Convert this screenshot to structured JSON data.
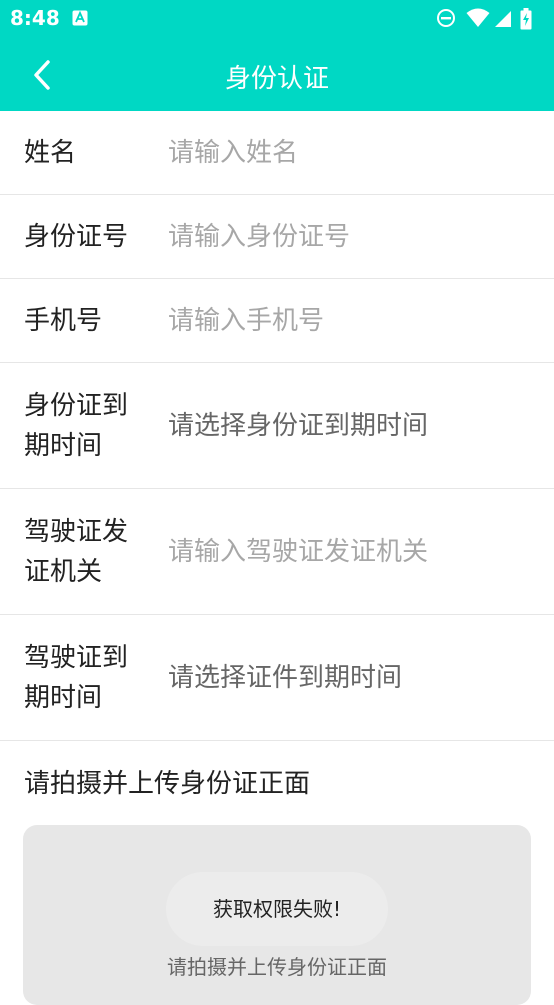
{
  "status_bar": {
    "time": "8:48",
    "icons": [
      "a-notification-icon",
      "do-not-disturb-icon",
      "wifi-icon",
      "cell-signal-icon",
      "battery-charging-icon"
    ]
  },
  "header": {
    "title": "身份认证",
    "background": "#00d8c4"
  },
  "form": {
    "rows": [
      {
        "label": "姓名",
        "placeholder": "请输入姓名"
      },
      {
        "label": "身份证号",
        "placeholder": "请输入身份证号"
      },
      {
        "label": "手机号",
        "placeholder": "请输入手机号"
      },
      {
        "label": "身份证到期时间",
        "label_lines": [
          "身份证到",
          "期时间"
        ],
        "placeholder": "请选择身份证到期时间"
      },
      {
        "label": "驾驶证发证机关",
        "label_lines": [
          "驾驶证发",
          "证机关"
        ],
        "placeholder": "请输入驾驶证发证机关"
      },
      {
        "label": "驾驶证到期时间",
        "label_lines": [
          "驾驶证到",
          "期时间"
        ],
        "placeholder": "请选择证件到期时间"
      }
    ]
  },
  "upload": {
    "heading": "请拍摄并上传身份证正面",
    "caption": "请拍摄并上传身份证正面"
  },
  "toast": {
    "message": "获取权限失败!"
  }
}
